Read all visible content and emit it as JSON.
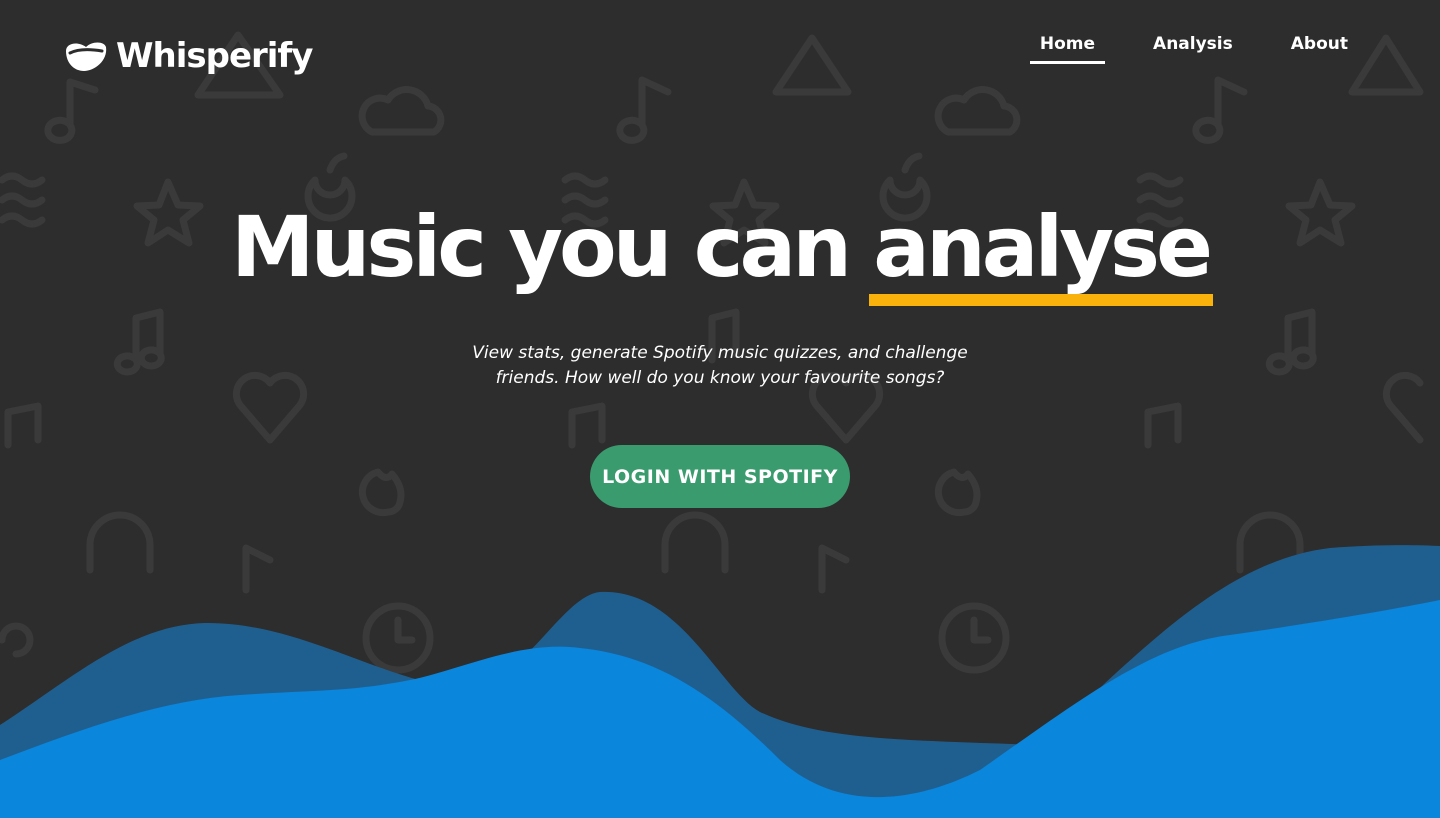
{
  "app": {
    "name": "Whisperify"
  },
  "nav": {
    "items": [
      {
        "label": "Home",
        "active": true
      },
      {
        "label": "Analysis",
        "active": false
      },
      {
        "label": "About",
        "active": false
      }
    ]
  },
  "hero": {
    "title_prefix": "Music you can ",
    "title_highlight": "analyse",
    "subtitle_line1": "View stats, generate Spotify music quizzes, and challenge",
    "subtitle_line2": "friends. How well do you know your favourite songs?",
    "cta_label": "LOGIN WITH SPOTIFY"
  },
  "colors": {
    "background": "#2d2d2d",
    "pattern": "#3a3a3a",
    "accent_underline": "#f9b10c",
    "cta": "#3a9b6e",
    "wave_back": "#1f5f90",
    "wave_front": "#0a86dc"
  },
  "icons": [
    "logo-icon",
    "music-note-icon",
    "cloud-icon",
    "triangle-icon",
    "star-icon",
    "apple-icon",
    "waves-icon",
    "heart-icon",
    "flame-icon",
    "headphones-icon",
    "clock-icon"
  ]
}
